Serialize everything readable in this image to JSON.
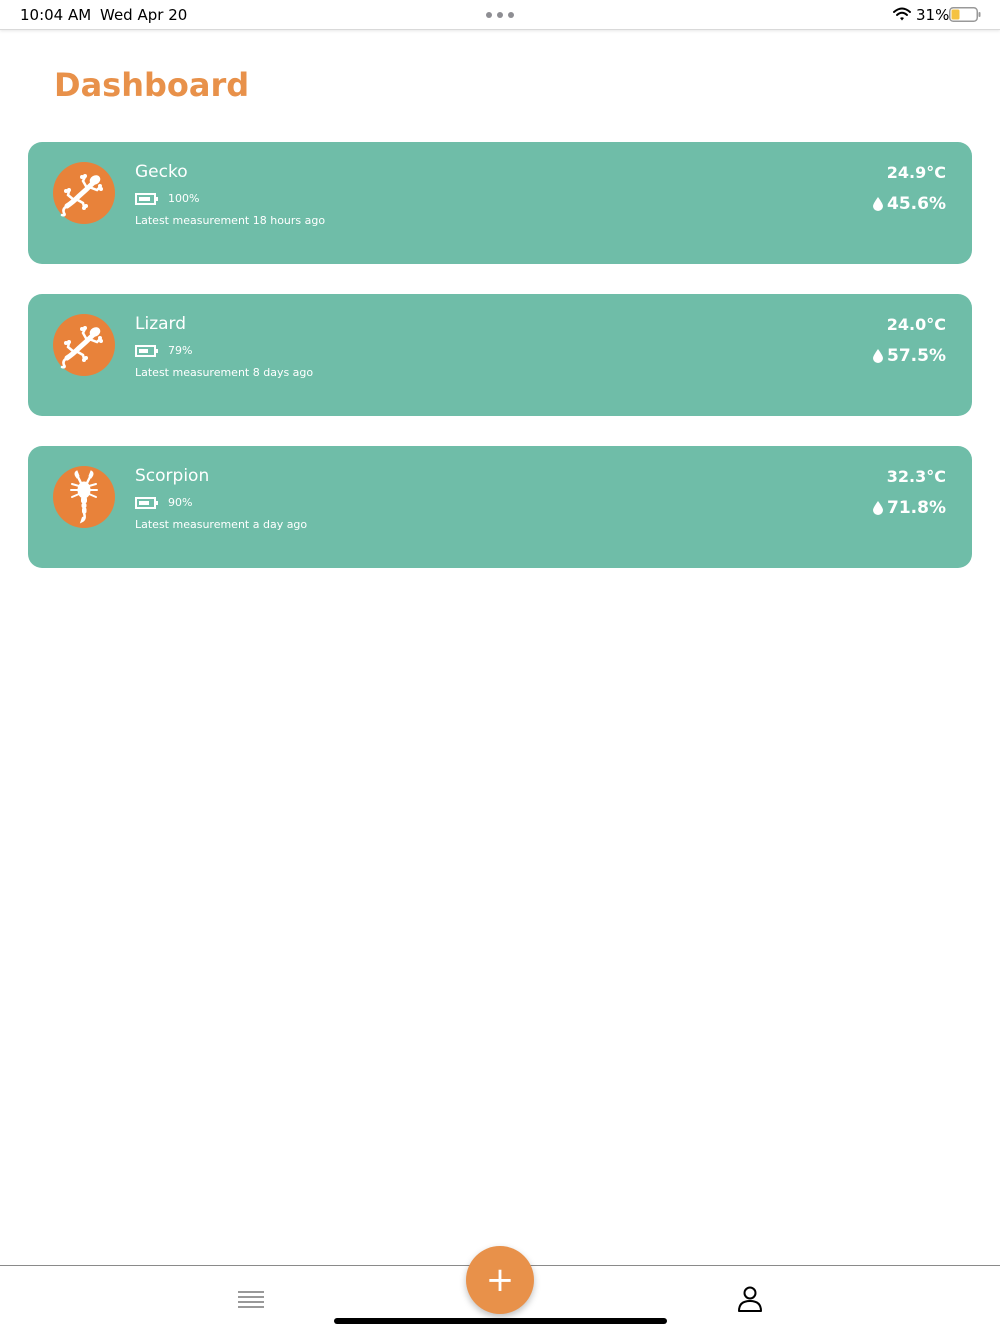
{
  "status_bar": {
    "time": "10:04 AM",
    "date": "Wed Apr 20",
    "battery_percent": "31%"
  },
  "page": {
    "title": "Dashboard"
  },
  "colors": {
    "accent": "#e8914a",
    "card_background": "#6fbda8",
    "avatar_background": "#e8823a",
    "battery_fill_status": "#f5c242"
  },
  "devices": [
    {
      "name": "Gecko",
      "icon": "gecko-icon",
      "battery": "100%",
      "latest": "Latest measurement 18 hours ago",
      "temperature": "24.9°C",
      "humidity": "45.6%"
    },
    {
      "name": "Lizard",
      "icon": "gecko-icon",
      "battery": "79%",
      "latest": "Latest measurement 8 days ago",
      "temperature": "24.0°C",
      "humidity": "57.5%"
    },
    {
      "name": "Scorpion",
      "icon": "scorpion-icon",
      "battery": "90%",
      "latest": "Latest measurement a day ago",
      "temperature": "32.3°C",
      "humidity": "71.8%"
    }
  ],
  "tab_bar": {
    "fab_label": "+",
    "tabs": [
      {
        "icon": "list-icon"
      },
      {
        "icon": "profile-icon"
      }
    ]
  }
}
